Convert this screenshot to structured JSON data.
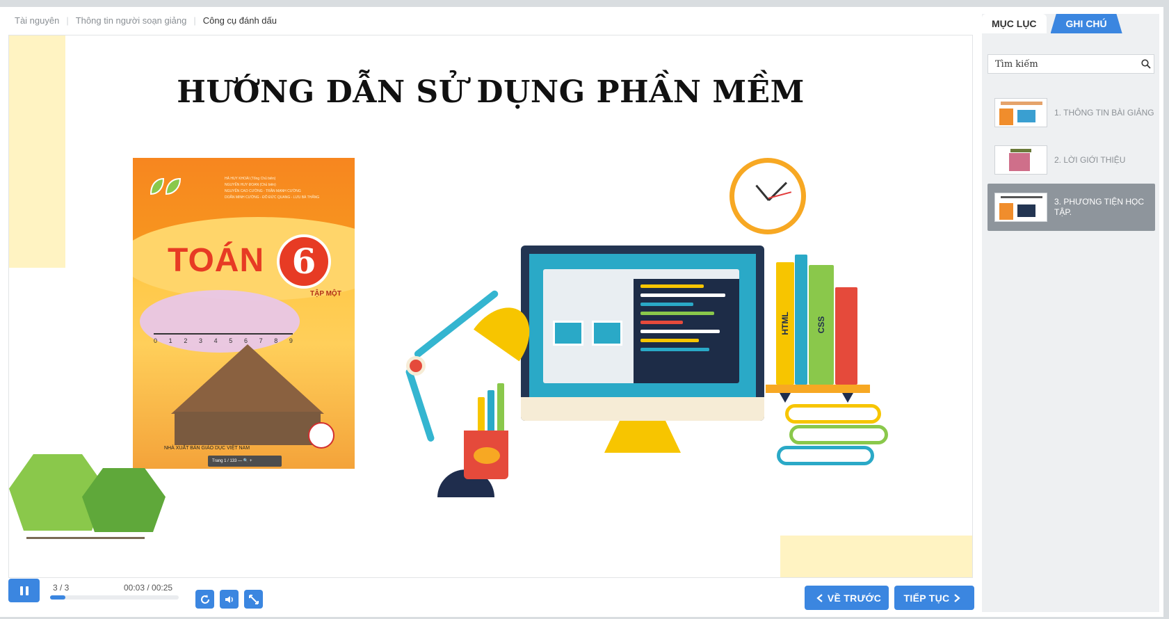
{
  "breadcrumb": {
    "items": [
      "Tài nguyên",
      "Thông tin người soạn giảng",
      "Công cụ đánh dấu"
    ],
    "separator": "|"
  },
  "slide": {
    "title": "HƯỚNG DẪN SỬ DỤNG PHẦN MỀM",
    "book": {
      "title": "TOÁN",
      "number": "6",
      "subtitle": "TẬP MỘT",
      "authors": [
        "HÀ HUY KHOÁI (Tổng Chủ biên)",
        "NGUYỄN HUY ĐOAN (Chủ biên)",
        "NGUYỄN CAO CƯỜNG - TRẦN MẠNH CƯỜNG",
        "DOÃN MINH CƯỜNG - ĐỖ ĐỨC QUANG - LƯU BÁ THẮNG"
      ],
      "number_line": [
        "0",
        "1",
        "2",
        "3",
        "4",
        "5",
        "6",
        "7",
        "8",
        "9"
      ],
      "publisher": "NHÀ XUẤT BẢN GIÁO DỤC VIỆT NAM",
      "pager": "Trang  1  /  133   —   🔍   +"
    },
    "shelf_books": [
      "HTML",
      "CSS"
    ]
  },
  "player": {
    "slide_counter": "3 / 3",
    "time": "00:03 / 00:25",
    "progress": 0.12,
    "prev_label": "VỀ TRƯỚC",
    "next_label": "TIẾP TỤC"
  },
  "sidebar": {
    "tabs": [
      "MỤC LỤC",
      "GHI CHÚ"
    ],
    "active_tab": "GHI CHÚ",
    "search_placeholder": "Tìm kiếm",
    "toc": [
      {
        "label": "1. THÔNG TIN BÀI GIẢNG",
        "active": false
      },
      {
        "label": "2. LỜI GIỚI THIỆU",
        "active": false
      },
      {
        "label": "3. PHƯƠNG TIỆN HỌC TẬP.",
        "active": true
      }
    ]
  },
  "colors": {
    "accent": "#3b86e0",
    "active_item": "#8e959c",
    "deco_yellow": "#fff3c2"
  }
}
